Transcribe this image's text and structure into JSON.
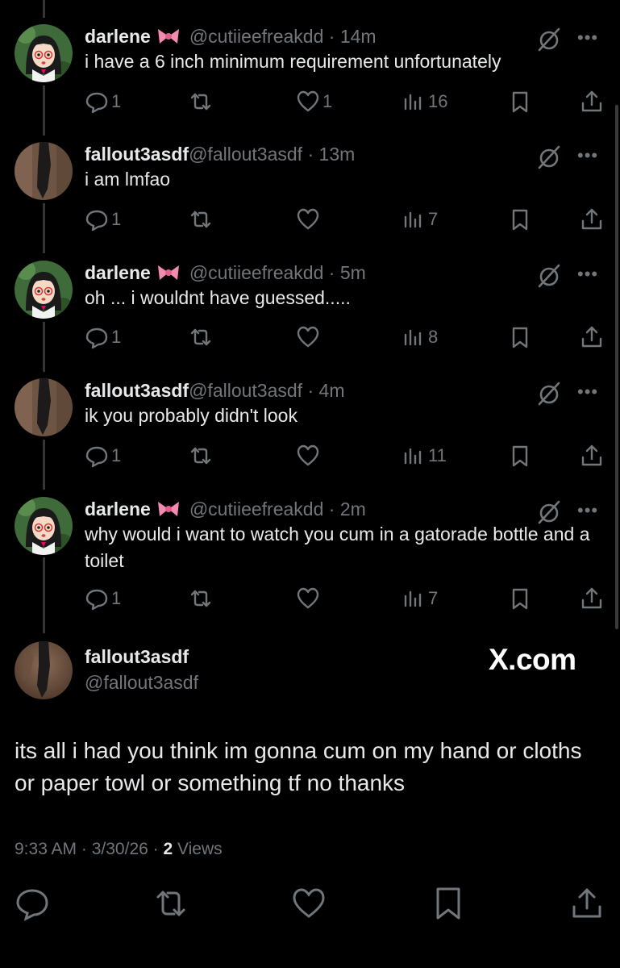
{
  "tweets": [
    {
      "name": "darlene",
      "emoji": "bow-emoji",
      "handle": "@cutiieefreakdd",
      "time": "14m",
      "text": "i have a 6 inch minimum requirement unfortunately",
      "replies": "1",
      "retweets": "",
      "likes": "1",
      "views": "16",
      "avatar": "anime-girl-avatar"
    },
    {
      "name": "fallout3asdf",
      "handle": "@fallout3asdf",
      "time": "13m",
      "text": "i am lmfao",
      "replies": "1",
      "retweets": "",
      "likes": "",
      "views": "7",
      "avatar": "dark-photo-avatar"
    },
    {
      "name": "darlene",
      "emoji": "bow-emoji",
      "handle": "@cutiieefreakdd",
      "time": "5m",
      "text": "oh ... i wouldnt have guessed.....",
      "replies": "1",
      "retweets": "",
      "likes": "",
      "views": "8",
      "avatar": "anime-girl-avatar"
    },
    {
      "name": "fallout3asdf",
      "handle": "@fallout3asdf",
      "time": "4m",
      "text": "ik you probably didn't look",
      "replies": "1",
      "retweets": "",
      "likes": "",
      "views": "11",
      "avatar": "dark-photo-avatar"
    },
    {
      "name": "darlene",
      "emoji": "bow-emoji",
      "handle": "@cutiieefreakdd",
      "time": "2m",
      "text": "why would i want to watch you cum in a gatorade bottle and a toilet",
      "replies": "1",
      "retweets": "",
      "likes": "",
      "views": "7",
      "avatar": "anime-girl-avatar"
    }
  ],
  "main_tweet": {
    "name": "fallout3asdf",
    "handle": "@fallout3asdf",
    "watermark": "X.com",
    "text": "its all i had you think im gonna cum on my hand or cloths or paper towl or something tf no thanks",
    "time": "9:33 AM",
    "date": "3/30/26",
    "views_count": "2",
    "views_label": "Views"
  },
  "colors": {
    "background": "#000000",
    "text": "#e7e9ea",
    "muted": "#71767b",
    "divider": "#333639"
  }
}
